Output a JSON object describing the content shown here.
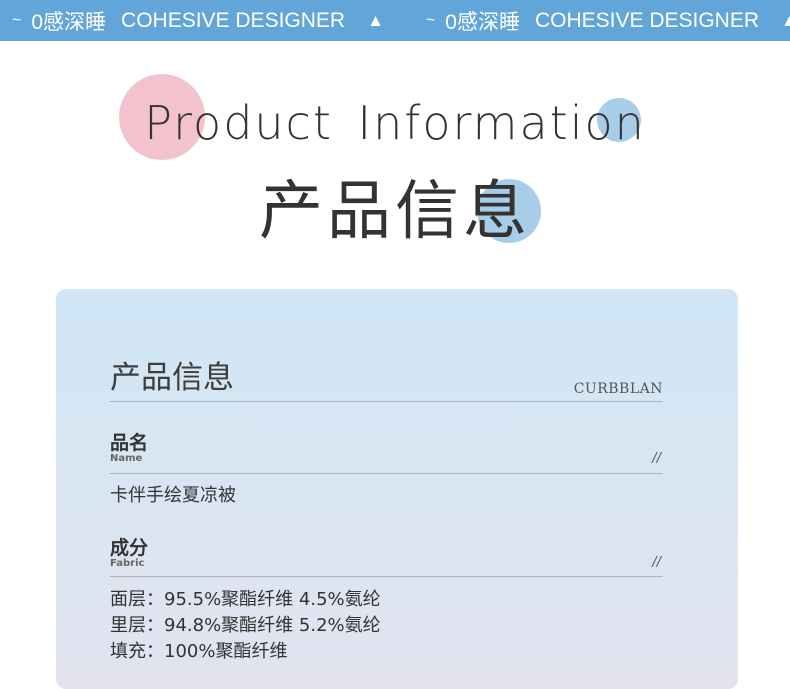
{
  "banner": {
    "segments": [
      {
        "tilde": "~",
        "text": "0感深睡",
        "brand": "COHESIVE DESIGNER",
        "triangle": "▲"
      },
      {
        "tilde": "~",
        "text": "0感深睡",
        "brand": "COHESIVE DESIGNER",
        "triangle": "▲"
      }
    ]
  },
  "header": {
    "en_title": "Product Information",
    "zh_title": "产品信息"
  },
  "colors": {
    "banner": "#62a6d9",
    "pink_circle": "#f3c3cd",
    "blue_circle": "#a7cde8"
  },
  "card": {
    "title": "产品信息",
    "brand": "CURBBLAN",
    "fields": [
      {
        "label_zh": "品名",
        "label_en": "Name",
        "mark": "//",
        "values": [
          "卡伴手绘夏凉被"
        ]
      },
      {
        "label_zh": "成分",
        "label_en": "Fabric",
        "mark": "//",
        "values": [
          "面层：95.5%聚酯纤维 4.5%氨纶",
          "里层：94.8%聚酯纤维 5.2%氨纶",
          "填充：100%聚酯纤维"
        ]
      }
    ]
  }
}
